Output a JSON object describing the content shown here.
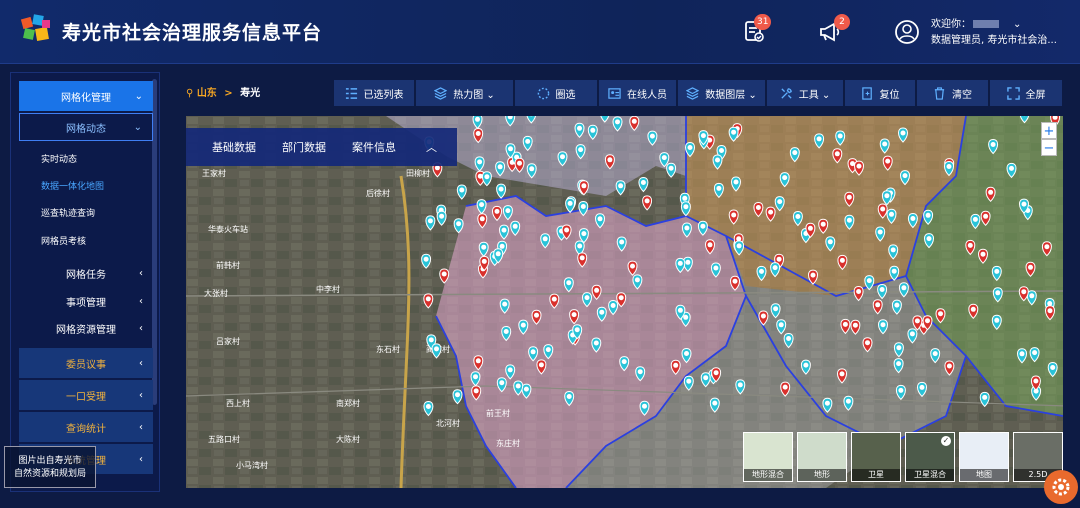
{
  "header": {
    "title": "寿光市社会治理服务信息平台",
    "tasks_badge": "31",
    "notice_badge": "2",
    "welcome": "欢迎你：",
    "user_role": "数据管理员, 寿光市社会治..."
  },
  "sidebar": {
    "items": [
      {
        "label": "网格化管理",
        "arrow": "⌄"
      },
      {
        "label": "网格动态",
        "arrow": "⌄"
      },
      {
        "label": "网格任务",
        "arrow": "‹"
      },
      {
        "label": "事项管理",
        "arrow": "‹"
      },
      {
        "label": "网格资源管理",
        "arrow": "‹"
      },
      {
        "label": "委员议事",
        "arrow": "‹"
      },
      {
        "label": "一口受理",
        "arrow": "‹"
      },
      {
        "label": "查询统计",
        "arrow": "‹"
      },
      {
        "label": "系统管理",
        "arrow": "‹"
      }
    ],
    "subitems": [
      {
        "label": "实时动态"
      },
      {
        "label": "数据一体化地图"
      },
      {
        "label": "巡查轨迹查询"
      },
      {
        "label": "网格员考核"
      }
    ]
  },
  "breadcrumb": {
    "province": "山东",
    "sep": ">",
    "city": "寿光"
  },
  "toolbar": {
    "tools": [
      "已选列表",
      "热力图 ⌄",
      "圈选",
      "在线人员",
      "数据图层 ⌄",
      "工具 ⌄",
      "复位",
      "清空",
      "全屏"
    ]
  },
  "map": {
    "tabs": [
      "基础数据",
      "部门数据",
      "案件信息"
    ],
    "collapse": "︿",
    "zoom_in": "+",
    "zoom_out": "−",
    "layers": [
      "地形混合",
      "地形",
      "卫星",
      "卫星混合",
      "地图",
      "2.5D"
    ],
    "labels": [
      "王家村",
      "华泰火车站",
      "前韩村",
      "大张村",
      "中李村",
      "吕家村",
      "东石村",
      "蔺家村",
      "西上村",
      "五路口村",
      "小马湾村",
      "南郑村",
      "大陈村",
      "北河村",
      "前王村",
      "东庄村",
      "田柳村",
      "后徐村"
    ]
  },
  "credit": {
    "line1": "图片出自寿光市",
    "line2": "自然资源和规划局"
  },
  "colors": {
    "accent": "#1a74e8",
    "marker_cyan": "#29c3d8",
    "marker_red": "#d9302c"
  }
}
